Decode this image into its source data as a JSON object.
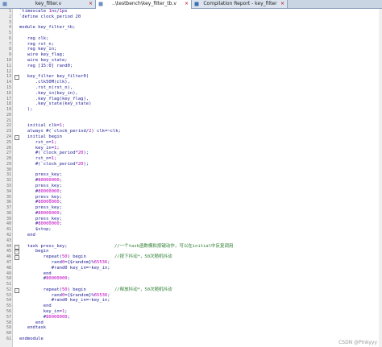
{
  "tabs": [
    {
      "label": "key_filter.v",
      "active": false
    },
    {
      "label": "..\\testbench\\key_filter_tb.v",
      "active": true
    },
    {
      "label": "Compilation Report - key_filter",
      "active": false
    }
  ],
  "code_lines": [
    {
      "n": "1",
      "text": "`timescale 1ns/1ps",
      "comment": "",
      "fold": ""
    },
    {
      "n": "2",
      "text": "`define clock_period 20",
      "comment": "",
      "fold": ""
    },
    {
      "n": "3",
      "text": "",
      "comment": "",
      "fold": ""
    },
    {
      "n": "4",
      "text": "module key_filter_tb;",
      "comment": "",
      "fold": ""
    },
    {
      "n": "5",
      "text": "",
      "comment": "",
      "fold": ""
    },
    {
      "n": "6",
      "text": "   reg clk;",
      "comment": "",
      "fold": ""
    },
    {
      "n": "7",
      "text": "   reg rst_n;",
      "comment": "",
      "fold": ""
    },
    {
      "n": "8",
      "text": "   reg key_in;",
      "comment": "",
      "fold": ""
    },
    {
      "n": "9",
      "text": "   wire key_flag;",
      "comment": "",
      "fold": ""
    },
    {
      "n": "10",
      "text": "   wire key_state;",
      "comment": "",
      "fold": ""
    },
    {
      "n": "11",
      "text": "   reg [15:0] rand0;",
      "comment": "",
      "fold": ""
    },
    {
      "n": "12",
      "text": "",
      "comment": "",
      "fold": ""
    },
    {
      "n": "13",
      "text": "   key_filter key_filter0(",
      "comment": "",
      "fold": "-"
    },
    {
      "n": "14",
      "text": "      .clk50M(clk),",
      "comment": "",
      "fold": ""
    },
    {
      "n": "15",
      "text": "      .rst_n(rst_n),",
      "comment": "",
      "fold": ""
    },
    {
      "n": "16",
      "text": "      .key_in(key_in),",
      "comment": "",
      "fold": ""
    },
    {
      "n": "17",
      "text": "      .key_flag(key_flag),",
      "comment": "",
      "fold": ""
    },
    {
      "n": "18",
      "text": "      .key_state(key_state)",
      "comment": "",
      "fold": ""
    },
    {
      "n": "19",
      "text": "   );",
      "comment": "",
      "fold": ""
    },
    {
      "n": "20",
      "text": "",
      "comment": "",
      "fold": ""
    },
    {
      "n": "21",
      "text": "",
      "comment": "",
      "fold": ""
    },
    {
      "n": "22",
      "text": "   initial clk=1;",
      "comment": "",
      "fold": ""
    },
    {
      "n": "23",
      "text": "   always #(`clock_period/2) clk=~clk;",
      "comment": "",
      "fold": ""
    },
    {
      "n": "24",
      "text": "   initial begin",
      "comment": "",
      "fold": "-"
    },
    {
      "n": "25",
      "text": "      rst_n=1;",
      "comment": "",
      "fold": ""
    },
    {
      "n": "26",
      "text": "      key_in=1;",
      "comment": "",
      "fold": ""
    },
    {
      "n": "27",
      "text": "      #(`clock_period*20);",
      "comment": "",
      "fold": ""
    },
    {
      "n": "28",
      "text": "      rst_n=1;",
      "comment": "",
      "fold": ""
    },
    {
      "n": "29",
      "text": "      #(`clock_period*20);",
      "comment": "",
      "fold": ""
    },
    {
      "n": "30",
      "text": "",
      "comment": "",
      "fold": ""
    },
    {
      "n": "31",
      "text": "      press_key;",
      "comment": "",
      "fold": ""
    },
    {
      "n": "32",
      "text": "      #80000000;",
      "comment": "",
      "fold": ""
    },
    {
      "n": "33",
      "text": "      press_key;",
      "comment": "",
      "fold": ""
    },
    {
      "n": "34",
      "text": "      #80000000;",
      "comment": "",
      "fold": ""
    },
    {
      "n": "35",
      "text": "      press_key;",
      "comment": "",
      "fold": ""
    },
    {
      "n": "36",
      "text": "      #80000000;",
      "comment": "",
      "fold": ""
    },
    {
      "n": "37",
      "text": "      press_key;",
      "comment": "",
      "fold": ""
    },
    {
      "n": "38",
      "text": "      #80000000;",
      "comment": "",
      "fold": ""
    },
    {
      "n": "39",
      "text": "      press_key;",
      "comment": "",
      "fold": ""
    },
    {
      "n": "40",
      "text": "      #80000000;",
      "comment": "",
      "fold": ""
    },
    {
      "n": "41",
      "text": "      $stop;",
      "comment": "",
      "fold": ""
    },
    {
      "n": "42",
      "text": "   end",
      "comment": "",
      "fold": ""
    },
    {
      "n": "43",
      "text": "",
      "comment": "",
      "fold": ""
    },
    {
      "n": "44",
      "text": "   task press_key;",
      "comment": "//一个task函数模拟按键动作，可以在initial中反复调用",
      "fold": "-"
    },
    {
      "n": "45",
      "text": "      begin",
      "comment": "",
      "fold": "-"
    },
    {
      "n": "46",
      "text": "         repeat(50) begin",
      "comment": "//按下抖动*，50次随机抖动",
      "fold": "-"
    },
    {
      "n": "47",
      "text": "            rand0={$random}%65536;",
      "comment": "",
      "fold": ""
    },
    {
      "n": "48",
      "text": "            #rand0 key_in=~key_in;",
      "comment": "",
      "fold": ""
    },
    {
      "n": "49",
      "text": "         end",
      "comment": "",
      "fold": ""
    },
    {
      "n": "50",
      "text": "         #80000000;",
      "comment": "",
      "fold": ""
    },
    {
      "n": "51",
      "text": "",
      "comment": "",
      "fold": ""
    },
    {
      "n": "52",
      "text": "         repeat(50) begin",
      "comment": "//释放抖动*，50次随机抖动",
      "fold": "-"
    },
    {
      "n": "53",
      "text": "            rand0={$random}%65536;",
      "comment": "",
      "fold": ""
    },
    {
      "n": "54",
      "text": "            #rand0 key_in=~key_in;",
      "comment": "",
      "fold": ""
    },
    {
      "n": "55",
      "text": "         end",
      "comment": "",
      "fold": ""
    },
    {
      "n": "56",
      "text": "         key_in=1;",
      "comment": "",
      "fold": ""
    },
    {
      "n": "57",
      "text": "         #80000000;",
      "comment": "",
      "fold": ""
    },
    {
      "n": "58",
      "text": "      end",
      "comment": "",
      "fold": ""
    },
    {
      "n": "59",
      "text": "   endtask",
      "comment": "",
      "fold": ""
    },
    {
      "n": "60",
      "text": "",
      "comment": "",
      "fold": ""
    },
    {
      "n": "61",
      "text": "endmodule",
      "comment": "",
      "fold": ""
    }
  ],
  "watermark": "CSDN @Pinkyyy",
  "colors": {
    "keyword": "#1e1e96",
    "number": "#c000c0",
    "comment": "#2e7d32",
    "tab_bar": "#c9d5e3"
  }
}
